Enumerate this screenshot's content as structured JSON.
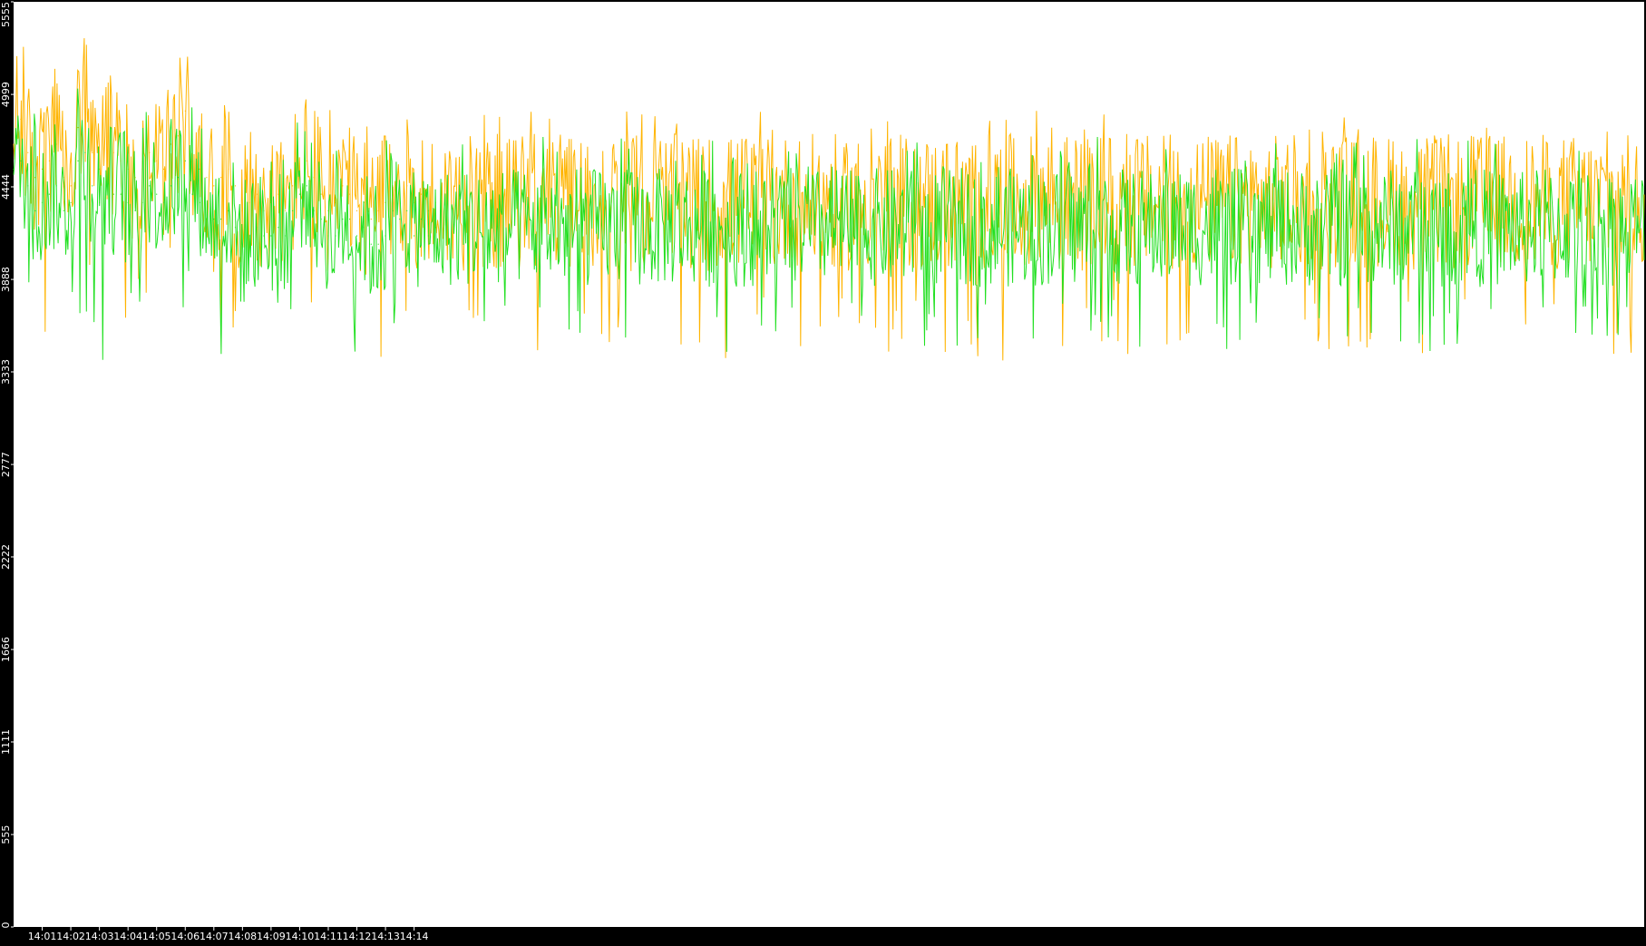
{
  "chart_data": {
    "type": "line",
    "title": "",
    "xlabel": "",
    "ylabel": "",
    "ylim": [
      0,
      5555
    ],
    "xlim_minutes": [
      14.0,
      14.95
    ],
    "grid": false,
    "legend": "none",
    "background": "#ffffff",
    "frame_color": "#000000",
    "y_ticks": [
      {
        "value": 0,
        "label": "0"
      },
      {
        "value": 555,
        "label": "555"
      },
      {
        "value": 1111,
        "label": "1111"
      },
      {
        "value": 1666,
        "label": "1666"
      },
      {
        "value": 2222,
        "label": "2222"
      },
      {
        "value": 2777,
        "label": "2777"
      },
      {
        "value": 3333,
        "label": "3333"
      },
      {
        "value": 3888,
        "label": "3888"
      },
      {
        "value": 4444,
        "label": "4444"
      },
      {
        "value": 4999,
        "label": "4999"
      },
      {
        "value": 5555,
        "label": "5555"
      }
    ],
    "x_ticks": [
      {
        "value": "14:01",
        "label": "14:01"
      },
      {
        "value": "14:02",
        "label": "14:02"
      },
      {
        "value": "14:03",
        "label": "14:03"
      },
      {
        "value": "14:04",
        "label": "14:04"
      },
      {
        "value": "14:05",
        "label": "14:05"
      },
      {
        "value": "14:06",
        "label": "14:06"
      },
      {
        "value": "14:07",
        "label": "14:07"
      },
      {
        "value": "14:08",
        "label": "14:08"
      },
      {
        "value": "14:09",
        "label": "14:09"
      },
      {
        "value": "14:10",
        "label": "14:10"
      },
      {
        "value": "14:11",
        "label": "14:11"
      },
      {
        "value": "14:12",
        "label": "14:12"
      },
      {
        "value": "14:13",
        "label": "14:13"
      },
      {
        "value": "14:14",
        "label": "14:14"
      }
    ],
    "series": [
      {
        "color": "#ffb400",
        "x": [
          "14:00:00",
          "14:00:15",
          "14:00:30",
          "14:00:45",
          "14:01:00",
          "14:01:15",
          "14:01:30",
          "14:01:45",
          "14:02:00",
          "14:02:15",
          "14:02:30",
          "14:02:45",
          "14:03:00",
          "14:03:15",
          "14:03:30",
          "14:03:45",
          "14:04:00",
          "14:04:15",
          "14:04:30",
          "14:04:45",
          "14:05:00",
          "14:05:15",
          "14:05:30",
          "14:05:45",
          "14:06:00",
          "14:06:15",
          "14:06:30",
          "14:06:45",
          "14:07:00",
          "14:07:15",
          "14:07:30",
          "14:07:45",
          "14:08:00",
          "14:08:15",
          "14:08:30",
          "14:08:45",
          "14:09:00",
          "14:09:15",
          "14:09:30",
          "14:09:45",
          "14:10:00",
          "14:10:15",
          "14:10:30",
          "14:10:45",
          "14:11:00",
          "14:11:15",
          "14:11:30",
          "14:11:45",
          "14:12:00",
          "14:12:15",
          "14:12:30",
          "14:12:45",
          "14:13:00",
          "14:13:15",
          "14:13:30",
          "14:13:45",
          "14:14:00",
          "14:14:15",
          "14:14:30",
          "14:14:45"
        ],
        "y": [
          4700,
          4850,
          4650,
          4500,
          4550,
          4600,
          4700,
          4500,
          4450,
          4800,
          4900,
          4650,
          4550,
          4700,
          4650,
          4600,
          4550,
          4500,
          4550,
          4650,
          4600,
          4550,
          4700,
          4750,
          4900,
          4600,
          4550,
          4500,
          4450,
          4500,
          4550,
          4450,
          4300,
          4350,
          4400,
          4300,
          4350,
          4400,
          4300,
          4450,
          4550,
          4600,
          4500,
          4400,
          4300,
          4350,
          4450,
          4400,
          4300,
          4350,
          4250,
          4300,
          4350,
          4450,
          4400,
          4450,
          4350,
          4400,
          4300,
          4350
        ],
        "min": [
          3600,
          3550,
          3650,
          3700,
          3500,
          3600,
          3750,
          3650,
          3850,
          3600,
          3650,
          3700,
          3500,
          3400,
          3450,
          3550,
          3650,
          3600,
          3750,
          3800,
          3700,
          3700,
          3750,
          3700,
          3600,
          3750,
          3800,
          3800,
          3750,
          3550,
          3650,
          3550,
          3300,
          3450,
          3550,
          3600,
          3400,
          3600,
          3650,
          3600,
          3750,
          3650,
          3500,
          3550,
          3500,
          3450,
          3400,
          3550,
          3400,
          3500,
          3350,
          3300,
          3450,
          3550,
          3450,
          3600,
          3400,
          3550,
          3300,
          3400
        ],
        "max": [
          5300,
          5350,
          5250,
          5150,
          5200,
          5100,
          5250,
          5150,
          5050,
          5200,
          5350,
          5150,
          5100,
          5200,
          5500,
          5150,
          5100,
          5050,
          5150,
          5200,
          5150,
          5150,
          5200,
          5250,
          5400,
          5200,
          5150,
          5100,
          5200,
          5150,
          5100,
          5150,
          5000,
          4950,
          5000,
          4950,
          4900,
          5000,
          5050,
          5300,
          5150,
          5200,
          5250,
          5150,
          4950,
          5000,
          5100,
          5000,
          4950,
          5050,
          4900,
          4950,
          4950,
          5100,
          5000,
          5150,
          4950,
          5050,
          5000,
          4900
        ]
      },
      {
        "color": "#22e022",
        "x": [
          "14:00:00",
          "14:00:15",
          "14:00:30",
          "14:00:45",
          "14:01:00",
          "14:01:15",
          "14:01:30",
          "14:01:45",
          "14:02:00",
          "14:02:15",
          "14:02:30",
          "14:02:45",
          "14:03:00",
          "14:03:15",
          "14:03:30",
          "14:03:45",
          "14:04:00",
          "14:04:15",
          "14:04:30",
          "14:04:45",
          "14:05:00",
          "14:05:15",
          "14:05:30",
          "14:05:45",
          "14:06:00",
          "14:06:15",
          "14:06:30",
          "14:06:45",
          "14:07:00",
          "14:07:15",
          "14:07:30",
          "14:07:45",
          "14:08:00",
          "14:08:15",
          "14:08:30",
          "14:08:45",
          "14:09:00",
          "14:09:15",
          "14:09:30",
          "14:09:45",
          "14:10:00",
          "14:10:15",
          "14:10:30",
          "14:10:45",
          "14:11:00",
          "14:11:15",
          "14:11:30",
          "14:11:45",
          "14:12:00",
          "14:12:15",
          "14:12:30",
          "14:12:45",
          "14:13:00",
          "14:13:15",
          "14:13:30",
          "14:13:45",
          "14:14:00",
          "14:14:15",
          "14:14:30",
          "14:14:45"
        ],
        "y": [
          4550,
          4600,
          4450,
          4300,
          4350,
          4400,
          4450,
          4300,
          4350,
          4600,
          4650,
          4450,
          4350,
          4450,
          4400,
          4400,
          4350,
          4300,
          4350,
          4450,
          4400,
          4350,
          4450,
          4500,
          4600,
          4400,
          4350,
          4250,
          4250,
          4250,
          4300,
          4200,
          4100,
          4150,
          4200,
          4150,
          4150,
          4200,
          4150,
          4300,
          4400,
          4450,
          4300,
          4250,
          4150,
          4150,
          4250,
          4250,
          4150,
          4200,
          4100,
          4100,
          4150,
          4300,
          4250,
          4300,
          4150,
          4250,
          4150,
          4200
        ],
        "min": [
          3900,
          3750,
          3700,
          3650,
          3650,
          3600,
          3700,
          3650,
          3800,
          3500,
          3600,
          3650,
          3400,
          3300,
          3650,
          3350,
          3550,
          3550,
          3650,
          3700,
          3650,
          3700,
          3700,
          3650,
          3650,
          3700,
          3750,
          3750,
          3700,
          3150,
          3650,
          3300,
          3200,
          3450,
          3450,
          3450,
          3350,
          3550,
          3550,
          3550,
          3650,
          3650,
          3550,
          3500,
          3450,
          3250,
          3450,
          3450,
          3450,
          3500,
          3350,
          3250,
          3450,
          3450,
          3500,
          3550,
          3400,
          3450,
          3300,
          3450
        ],
        "max": [
          5100,
          5050,
          4950,
          4900,
          4950,
          5050,
          5100,
          4950,
          4900,
          5150,
          5150,
          5000,
          4950,
          5050,
          5000,
          4900,
          4950,
          4850,
          4900,
          5050,
          4950,
          4950,
          5000,
          5050,
          5150,
          4950,
          4900,
          4850,
          4850,
          4900,
          4850,
          4800,
          4700,
          4750,
          4800,
          4750,
          4750,
          4800,
          4800,
          4900,
          4950,
          5000,
          4850,
          4800,
          4750,
          4750,
          4850,
          4800,
          4750,
          4800,
          4700,
          4700,
          4750,
          5100,
          4850,
          4900,
          4750,
          4800,
          4700,
          4750
        ]
      }
    ]
  }
}
